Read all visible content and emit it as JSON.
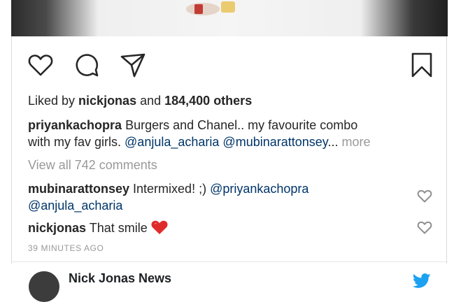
{
  "post": {
    "likes": {
      "prefix": "Liked by ",
      "user": "nickjonas",
      "middle": " and ",
      "count": "184,400 others"
    },
    "caption": {
      "user": "priyankachopra",
      "text_line1": " Burgers and Chanel.. my favourite combo",
      "text_line2": "with my fav girls. ",
      "mention1": "@anjula_acharia",
      "mention2": "@mubinarattonsey",
      "ellipsis": "...",
      "more_label": "more"
    },
    "view_all_comments": "View all 742 comments",
    "comments": [
      {
        "user": "mubinarattonsey",
        "text": " Intermixed! ;) ",
        "mention1": "@priyankachopra",
        "mention2": "@anjula_acharia"
      },
      {
        "user": "nickjonas",
        "text": " That smile"
      }
    ],
    "timestamp": "39 MINUTES AGO"
  },
  "footer": {
    "account_name": "Nick Jonas News"
  },
  "icons": {
    "like": "heart-icon",
    "comment": "comment-icon",
    "share": "share-icon",
    "save": "bookmark-icon",
    "emoji": "red-heart-emoji",
    "brand": "twitter-bird-icon"
  },
  "colors": {
    "text": "#262626",
    "muted": "#999999",
    "mention": "#003569",
    "emoji_heart": "#e02b2b",
    "twitter": "#1da1f2"
  }
}
